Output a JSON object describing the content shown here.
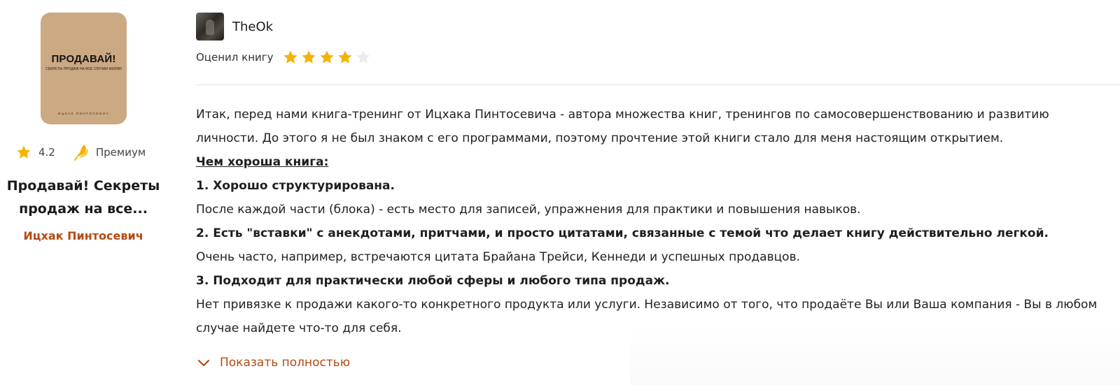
{
  "book": {
    "cover": {
      "title": "ПРОДАВАЙ!",
      "subtitle": "СЕКРЕТЫ ПРОДАЖ НА ВСЕ СЛУЧАИ ЖИЗНИ",
      "author": "ИЦХАК ПИНТОСЕВИЧ",
      "color": "#cba983"
    },
    "rating": "4.2",
    "premium_label": "Премиум",
    "title": "Продавай! Секреты продаж на все...",
    "author": "Ицхак Пинтосевич",
    "author_color": "#b24a12"
  },
  "review": {
    "reviewer": {
      "name": "TheOk"
    },
    "rated_label": "Оценил книгу",
    "stars": {
      "filled": 4,
      "total": 5,
      "filled_color": "#f5b301",
      "empty_color": "#ececec"
    },
    "paragraphs": {
      "p1": "Итак, перед нами книга-тренинг от Ицхака Пинтосевича - автора множества книг, тренингов по самосовершенствованию и развитию личности. До этого я не был знаком с его программами, поэтому прочтение этой книги стало для меня настоящим открытием.",
      "h1": "Чем хороша книга:",
      "p2_title": "1. Хорошо структурирована.",
      "p2": "После каждой части (блока) - есть место для записей, упражнения для практики и повышения навыков.",
      "p3_title": "2. Есть \"вставки\" с анекдотами, притчами, и просто цитатами, связанные с темой что делает книгу действительно легкой.",
      "p3": "Очень часто, например, встречаются цитата Брайана Трейси, Кеннеди и успешных продавцов.",
      "p4_title": "3. Подходит для практически любой сферы и любого типа продаж.",
      "p4": "Нет привязке к продажи какого-то конкретного продукта или услуги. Независимо от того, что продаёте Вы или Ваша компания - Вы в любом случае найдете что-то для себя."
    },
    "show_more_label": "Показать полностью",
    "accent_color": "#b24a12"
  },
  "icons": {
    "star": "star-icon",
    "premium": "premium-icon",
    "chevron": "chevron-down-icon"
  }
}
